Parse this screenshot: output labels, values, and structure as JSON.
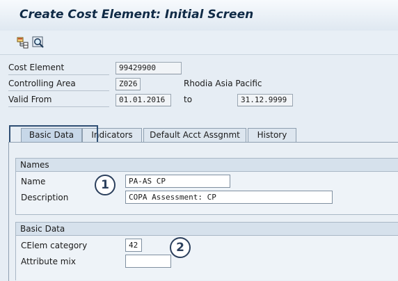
{
  "window": {
    "title": "Create Cost Element: Initial Screen"
  },
  "toolbar": {
    "icons": [
      "hierarchy-icon",
      "magnifier-icon"
    ]
  },
  "header_fields": {
    "cost_element": {
      "label": "Cost Element",
      "value": "99429900"
    },
    "controlling_area": {
      "label": "Controlling Area",
      "value": "Z026",
      "description": "Rhodia Asia Pacific"
    },
    "valid_from": {
      "label": "Valid From",
      "value": "01.01.2016",
      "to_label": "to",
      "to_value": "31.12.9999"
    }
  },
  "tabs": [
    {
      "label": "Basic Data",
      "active": true
    },
    {
      "label": "Indicators",
      "active": false
    },
    {
      "label": "Default Acct Assgnmt",
      "active": false
    },
    {
      "label": "History",
      "active": false
    }
  ],
  "names_group": {
    "title": "Names",
    "name": {
      "label": "Name",
      "value": "PA-AS CP"
    },
    "description": {
      "label": "Description",
      "value": "COPA Assessment: CP"
    }
  },
  "basic_data_group": {
    "title": "Basic Data",
    "celem_category": {
      "label": "CElem category",
      "value": "42"
    },
    "attribute_mix": {
      "label": "Attribute mix",
      "value": ""
    }
  },
  "annotations": [
    "1",
    "2"
  ]
}
